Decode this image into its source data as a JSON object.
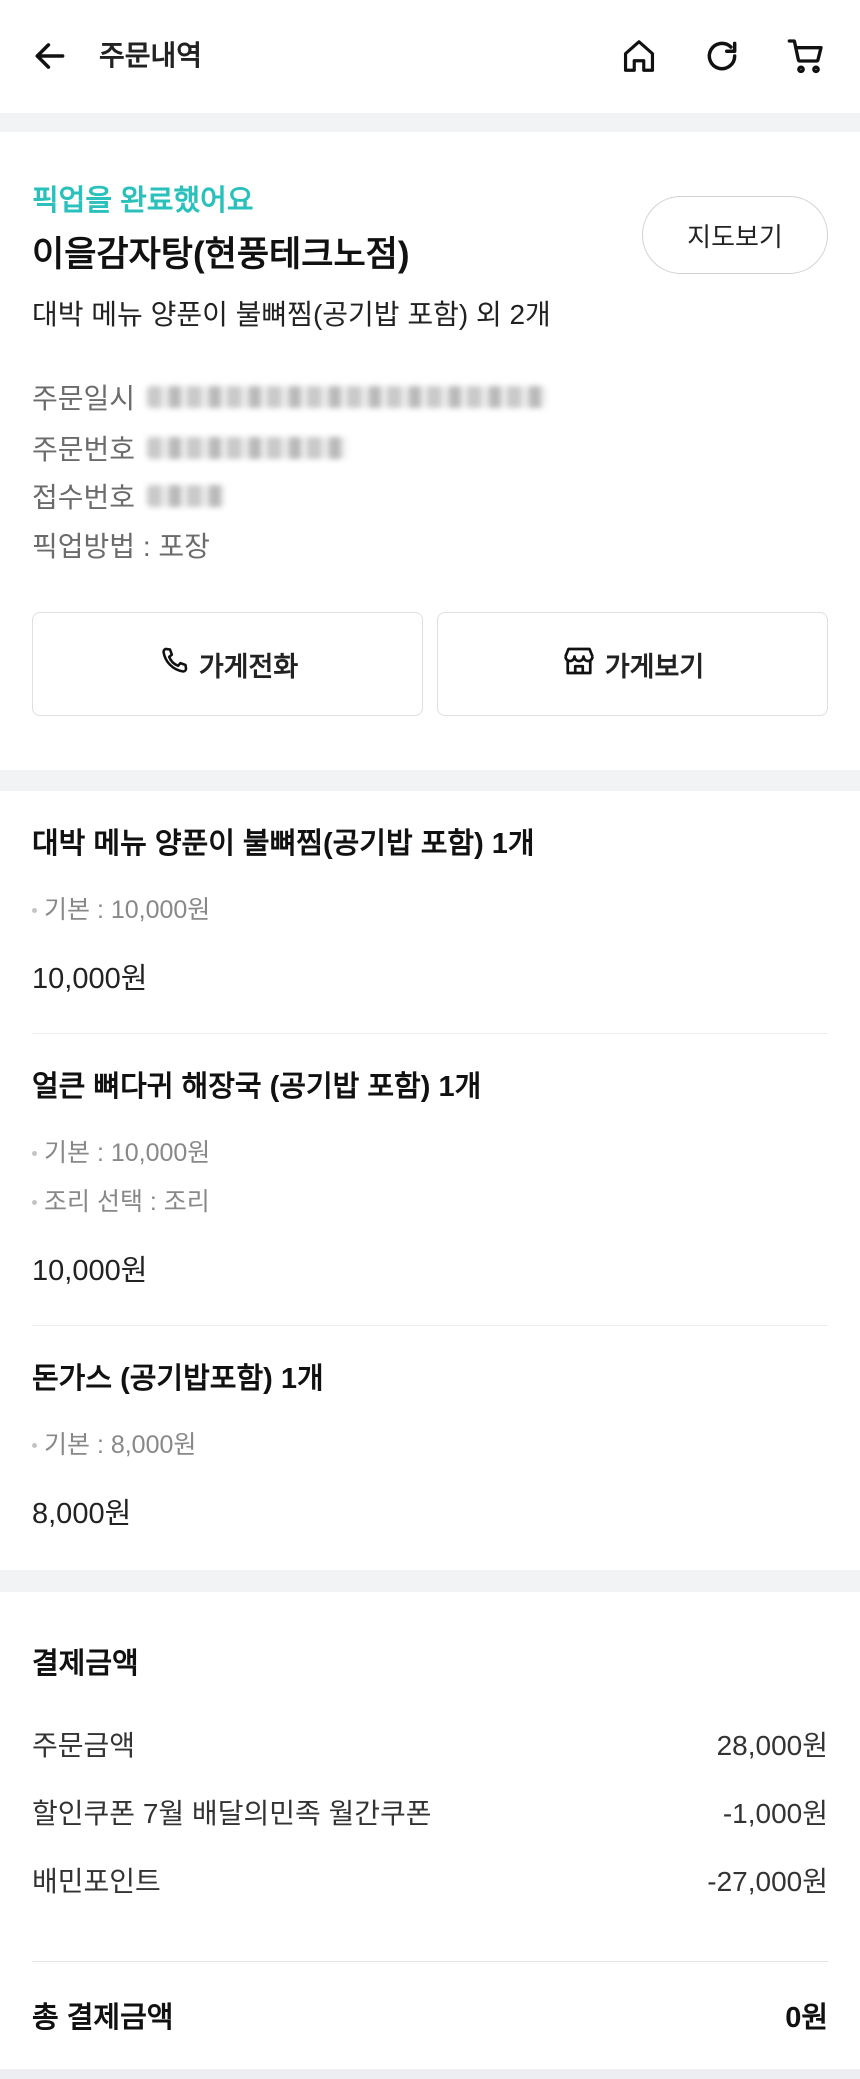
{
  "header": {
    "title": "주문내역",
    "icons": [
      "back-arrow-icon",
      "home-icon",
      "refresh-icon",
      "cart-icon"
    ]
  },
  "order": {
    "status": "픽업을 완료했어요",
    "store_name": "이을감자탕(현풍테크노점)",
    "map_button": "지도보기",
    "summary": "대박 메뉴 양푼이 불뼈찜(공기밥 포함) 외 2개",
    "info": {
      "order_date_label": "주문일시",
      "order_number_label": "주문번호",
      "receipt_number_label": "접수번호",
      "pickup_method": "픽업방법 : 포장"
    },
    "call_button": "가게전화",
    "store_button": "가게보기"
  },
  "items": [
    {
      "name": "대박 메뉴 양푼이 불뼈찜(공기밥 포함) 1개",
      "options": [
        "기본 : 10,000원"
      ],
      "price": "10,000원"
    },
    {
      "name": "얼큰 뼈다귀 해장국 (공기밥 포함) 1개",
      "options": [
        "기본 : 10,000원",
        "조리 선택 : 조리"
      ],
      "price": "10,000원"
    },
    {
      "name": "돈가스 (공기밥포함) 1개",
      "options": [
        "기본 : 8,000원"
      ],
      "price": "8,000원"
    }
  ],
  "payment": {
    "title": "결제금액",
    "rows": [
      {
        "label": "주문금액",
        "value": "28,000원"
      },
      {
        "label": "할인쿠폰 7월 배달의민족 월간쿠폰",
        "value": "-1,000원"
      },
      {
        "label": "배민포인트",
        "value": "-27,000원"
      }
    ],
    "total_label": "총 결제금액",
    "total_value": "0원"
  },
  "colors": {
    "accent": "#2ac1bc",
    "background_band": "#f2f3f5",
    "text": "#222222",
    "muted": "#888888"
  }
}
